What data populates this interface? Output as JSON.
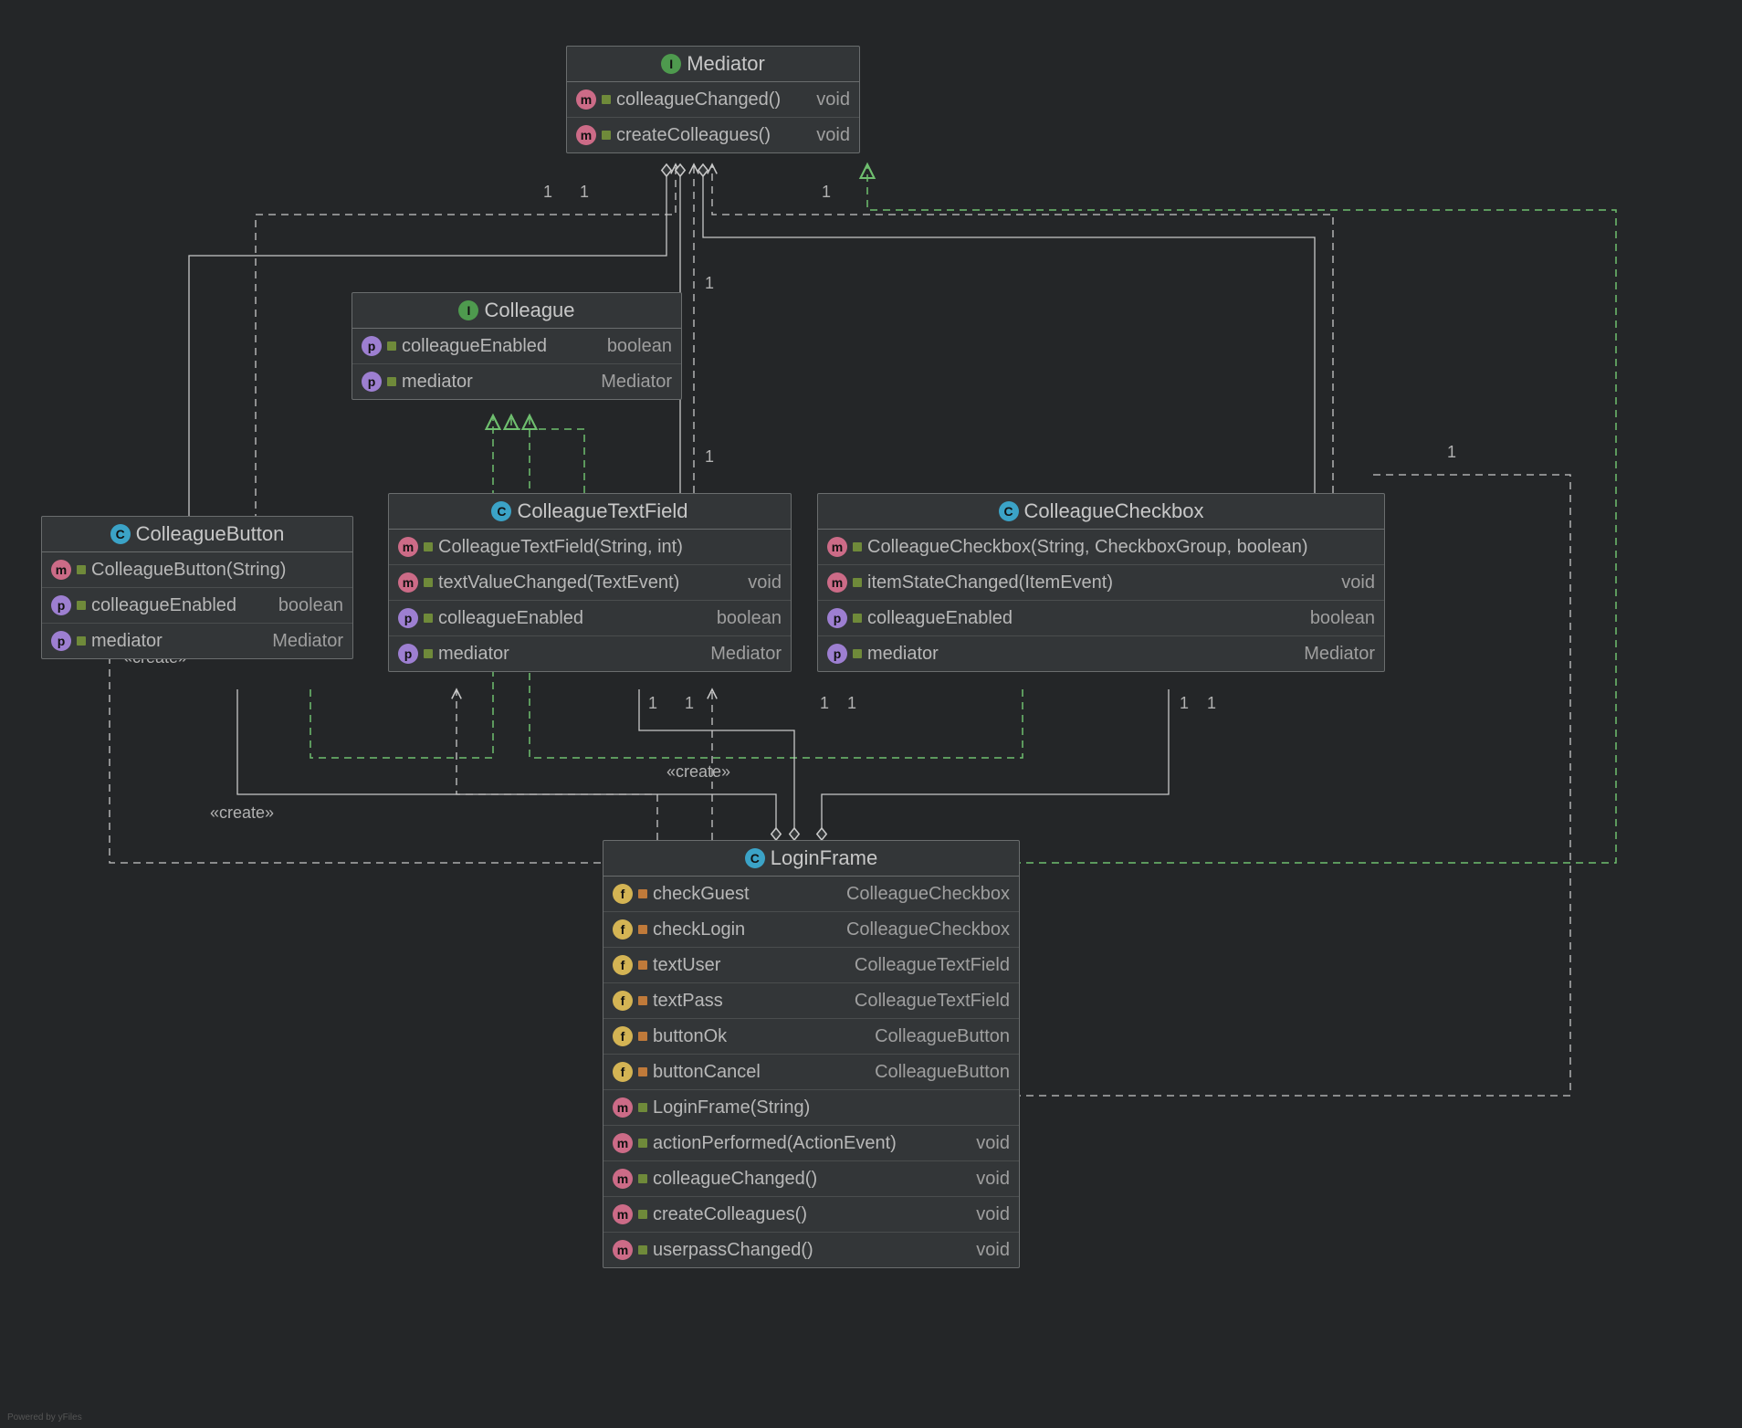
{
  "classes": {
    "mediator": {
      "title": "Mediator",
      "icon": "interface",
      "rows": [
        {
          "icon": "method",
          "sig": "colleagueChanged()",
          "type": "void"
        },
        {
          "icon": "method",
          "sig": "createColleagues()",
          "type": "void"
        }
      ]
    },
    "colleague": {
      "title": "Colleague",
      "icon": "interface",
      "rows": [
        {
          "icon": "property",
          "sig": "colleagueEnabled",
          "type": "boolean"
        },
        {
          "icon": "property",
          "sig": "mediator",
          "type": "Mediator"
        }
      ]
    },
    "colleagueButton": {
      "title": "ColleagueButton",
      "icon": "class",
      "rows": [
        {
          "icon": "method",
          "sig": "ColleagueButton(String)",
          "type": ""
        },
        {
          "icon": "property",
          "sig": "colleagueEnabled",
          "type": "boolean"
        },
        {
          "icon": "property",
          "sig": "mediator",
          "type": "Mediator"
        }
      ]
    },
    "colleagueTextField": {
      "title": "ColleagueTextField",
      "icon": "class",
      "rows": [
        {
          "icon": "method",
          "sig": "ColleagueTextField(String, int)",
          "type": ""
        },
        {
          "icon": "method",
          "sig": "textValueChanged(TextEvent)",
          "type": "void"
        },
        {
          "icon": "property",
          "sig": "colleagueEnabled",
          "type": "boolean"
        },
        {
          "icon": "property",
          "sig": "mediator",
          "type": "Mediator"
        }
      ]
    },
    "colleagueCheckbox": {
      "title": "ColleagueCheckbox",
      "icon": "class",
      "rows": [
        {
          "icon": "method",
          "sig": "ColleagueCheckbox(String, CheckboxGroup, boolean)",
          "type": ""
        },
        {
          "icon": "method",
          "sig": "itemStateChanged(ItemEvent)",
          "type": "void"
        },
        {
          "icon": "property",
          "sig": "colleagueEnabled",
          "type": "boolean"
        },
        {
          "icon": "property",
          "sig": "mediator",
          "type": "Mediator"
        }
      ]
    },
    "loginFrame": {
      "title": "LoginFrame",
      "icon": "class",
      "rows": [
        {
          "icon": "field",
          "sig": "checkGuest",
          "type": "ColleagueCheckbox"
        },
        {
          "icon": "field",
          "sig": "checkLogin",
          "type": "ColleagueCheckbox"
        },
        {
          "icon": "field",
          "sig": "textUser",
          "type": "ColleagueTextField"
        },
        {
          "icon": "field",
          "sig": "textPass",
          "type": "ColleagueTextField"
        },
        {
          "icon": "field",
          "sig": "buttonOk",
          "type": "ColleagueButton"
        },
        {
          "icon": "field",
          "sig": "buttonCancel",
          "type": "ColleagueButton"
        },
        {
          "icon": "method",
          "sig": "LoginFrame(String)",
          "type": ""
        },
        {
          "icon": "method",
          "sig": "actionPerformed(ActionEvent)",
          "type": "void"
        },
        {
          "icon": "method",
          "sig": "colleagueChanged()",
          "type": "void"
        },
        {
          "icon": "method",
          "sig": "createColleagues()",
          "type": "void"
        },
        {
          "icon": "method",
          "sig": "userpassChanged()",
          "type": "void"
        }
      ]
    }
  },
  "labels": {
    "create1": "«create»",
    "create2": "«create»",
    "create3": "«create»",
    "m1a": "1",
    "m1b": "1",
    "m1c": "1",
    "m1d": "1",
    "m1e": "1",
    "cb1": "1",
    "cb2": "1",
    "cb3": "1",
    "cb4": "1",
    "cb5": "1",
    "cb6": "1"
  },
  "credit": "Powered by yFiles"
}
